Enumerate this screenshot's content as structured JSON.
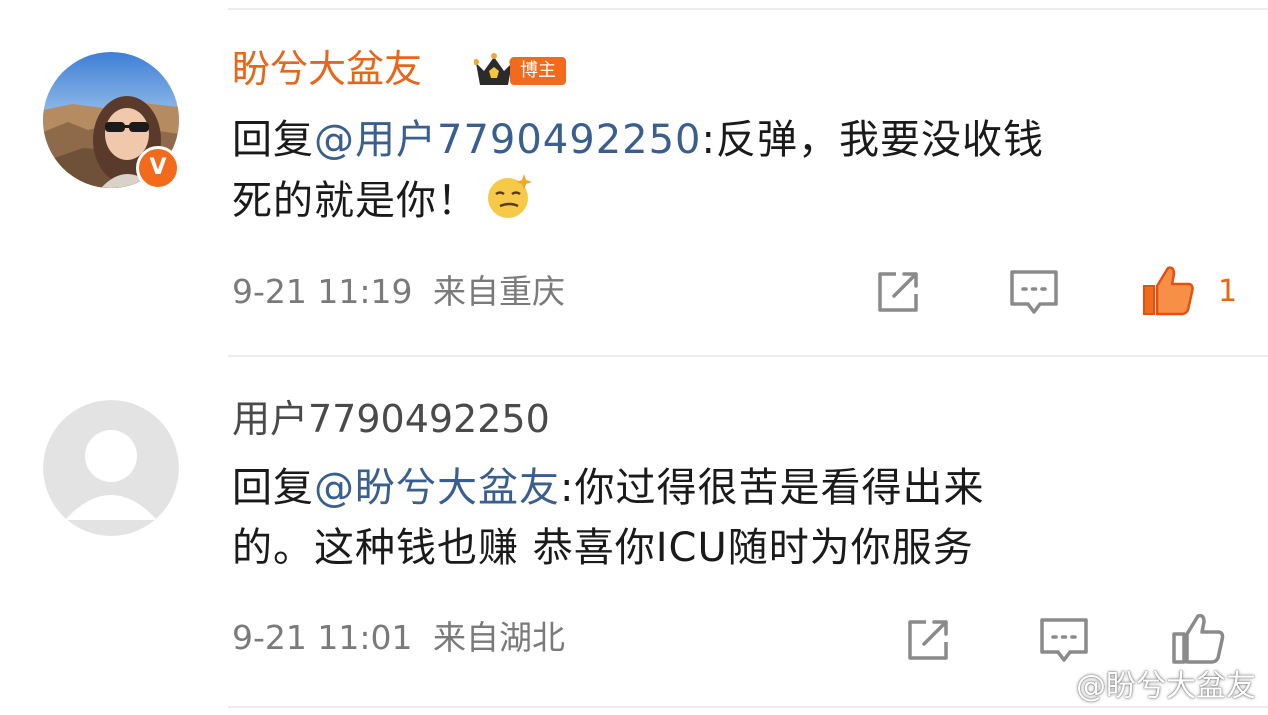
{
  "comments": [
    {
      "username": "盼兮大盆友",
      "role_badge": "博主",
      "verified_mark": "V",
      "reply_prefix": "回复",
      "mention": "@用户7790492250",
      "text_after_mention": ":反弹，我要没收钱\n死的就是你！",
      "emoji_icon": "smug-face-emoji",
      "timestamp": "9-21 11:19",
      "location": "来自重庆",
      "like_count": "1",
      "liked": true
    },
    {
      "username": "用户7790492250",
      "reply_prefix": "回复",
      "mention": "@盼兮大盆友",
      "text_after_mention": ":你过得很苦是看得出来\n的。这种钱也赚 恭喜你ICU随时为你服务",
      "timestamp": "9-21 11:01",
      "location": "来自湖北",
      "like_count": "",
      "liked": false
    }
  ],
  "watermark": "@盼兮大盆友",
  "colors": {
    "accent": "#e8661a",
    "mention": "#3a5f8f",
    "meta": "#7a7a7a",
    "divider": "#ececec"
  }
}
